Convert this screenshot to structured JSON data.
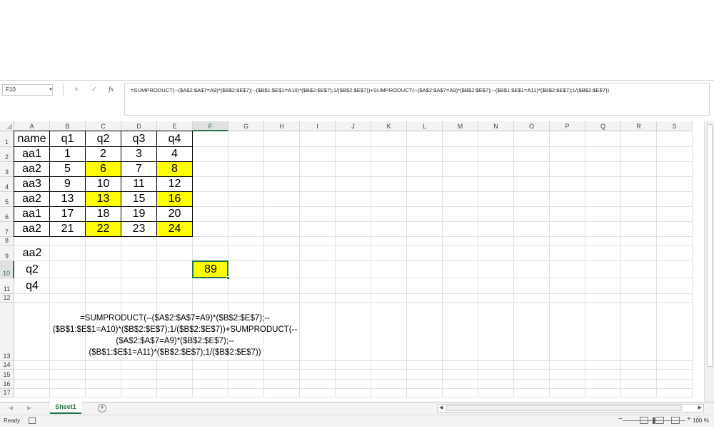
{
  "formula_bar": {
    "name_box": "F10",
    "cancel_icon": "×",
    "enter_icon": "✓",
    "fx_icon": "fx",
    "formula": "=SUMPRODUCT(--($A$2:$A$7=A9)*($B$2:$E$7);--($B$1:$E$1=A10)*($B$2:$E$7);1/($B$2:$E$7))+SUMPRODUCT(--($A$2:$A$7=A9)*($B$2:$E$7);--($B$1:$E$1=A11)*($B$2:$E$7);1/($B$2:$E$7))"
  },
  "grid": {
    "columns": [
      "A",
      "B",
      "C",
      "D",
      "E",
      "F",
      "G",
      "H",
      "I",
      "J",
      "K",
      "L",
      "M",
      "N",
      "O",
      "P",
      "Q",
      "R",
      "S"
    ],
    "rows": [
      "1",
      "2",
      "3",
      "4",
      "5",
      "6",
      "7",
      "8",
      "9",
      "10",
      "11",
      "12",
      "13",
      "14",
      "15",
      "16",
      "17"
    ],
    "active_column": "F",
    "active_row": "10",
    "table": [
      [
        "name",
        "q1",
        "q2",
        "q3",
        "q4"
      ],
      [
        "aa1",
        "1",
        "2",
        "3",
        "4"
      ],
      [
        "aa2",
        "5",
        "6",
        "7",
        "8"
      ],
      [
        "aa3",
        "9",
        "10",
        "11",
        "12"
      ],
      [
        "aa2",
        "13",
        "13",
        "15",
        "16"
      ],
      [
        "aa1",
        "17",
        "18",
        "19",
        "20"
      ],
      [
        "aa2",
        "21",
        "22",
        "23",
        "24"
      ]
    ],
    "highlight_color": "#ffff00",
    "criteria": [
      "aa2",
      "q2",
      "q4"
    ],
    "result": "89",
    "formula_text_lines": [
      "=SUMPRODUCT(--($A$2:$A$7=A9)*($B$2:$E$7);--",
      "($B$1:$E$1=A10)*($B$2:$E$7);1/($B$2:$E$7))+SUMPRODUCT(--",
      "($A$2:$A$7=A9)*($B$2:$E$7);--",
      "($B$1:$E$1=A11)*($B$2:$E$7);1/($B$2:$E$7))"
    ]
  },
  "sheet_tabs": {
    "active": "Sheet1",
    "add_icon": "+"
  },
  "status_bar": {
    "ready": "Ready",
    "zoom": "100 %"
  }
}
